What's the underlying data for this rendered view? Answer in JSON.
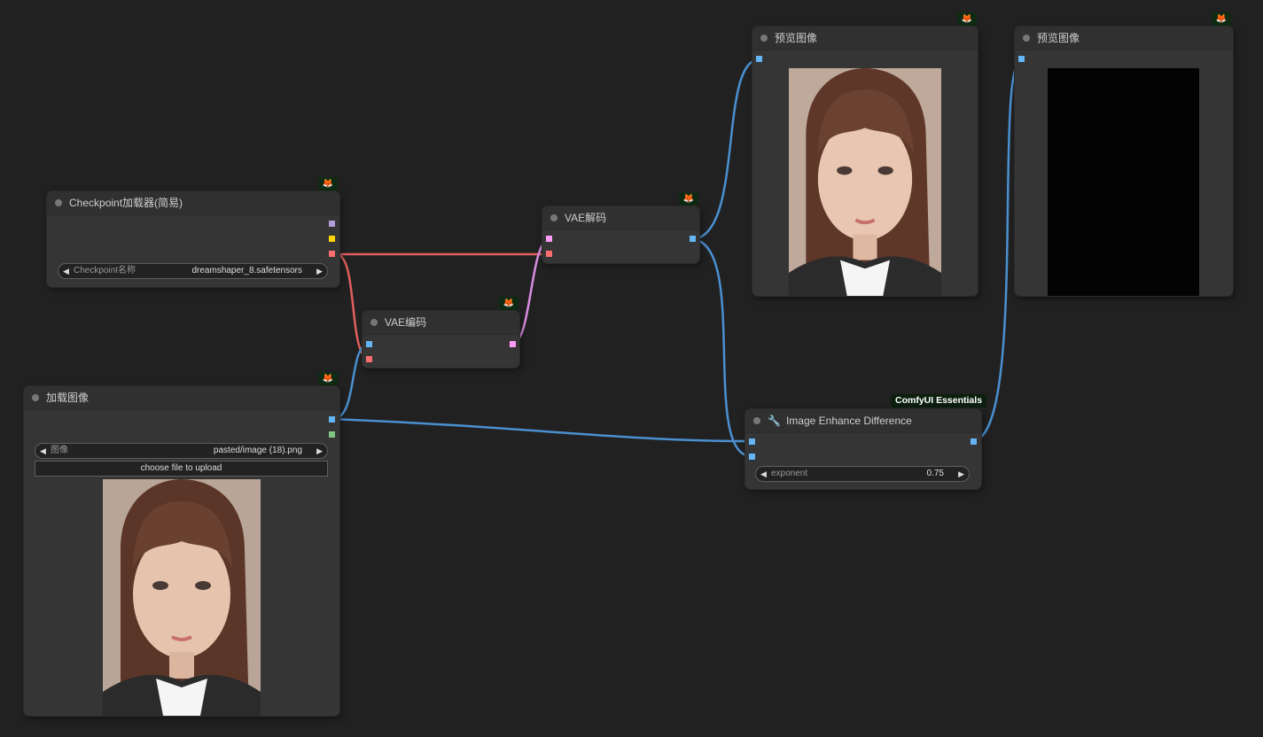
{
  "nodes": {
    "checkpoint_loader": {
      "title": "Checkpoint加载器(简易)",
      "widget_label": "Checkpoint名称",
      "widget_value": "dreamshaper_8.safetensors"
    },
    "vae_encode": {
      "title": "VAE编码"
    },
    "vae_decode": {
      "title": "VAE解码"
    },
    "load_image": {
      "title": "加载图像",
      "widget_label": "图像",
      "widget_value": "pasted/image (18).png",
      "upload_label": "choose file to upload"
    },
    "preview_1": {
      "title": "预览图像"
    },
    "preview_2": {
      "title": "预览图像"
    },
    "enhance_diff": {
      "title": "Image Enhance Difference",
      "badge": "ComfyUI Essentials",
      "widget_label": "exponent",
      "widget_value": "0.75"
    }
  },
  "icons": {
    "node_badge": "fox-icon",
    "title_dot": "circle-icon",
    "wrench": "wrench-icon",
    "arrow_left": "triangle-left-icon",
    "arrow_right": "triangle-right-icon"
  },
  "colors": {
    "canvas": "#212121",
    "model_slot": "#b39ddb",
    "clip_slot": "#ffd500",
    "vae_slot": "#ff6e6e",
    "image_slot": "#64b5f6",
    "mask_slot": "#81c784",
    "latent_slot": "#ff9cf9",
    "vae_link": "#e05f5f",
    "latent_link": "#d88de0",
    "image_link": "#4a90d0"
  }
}
